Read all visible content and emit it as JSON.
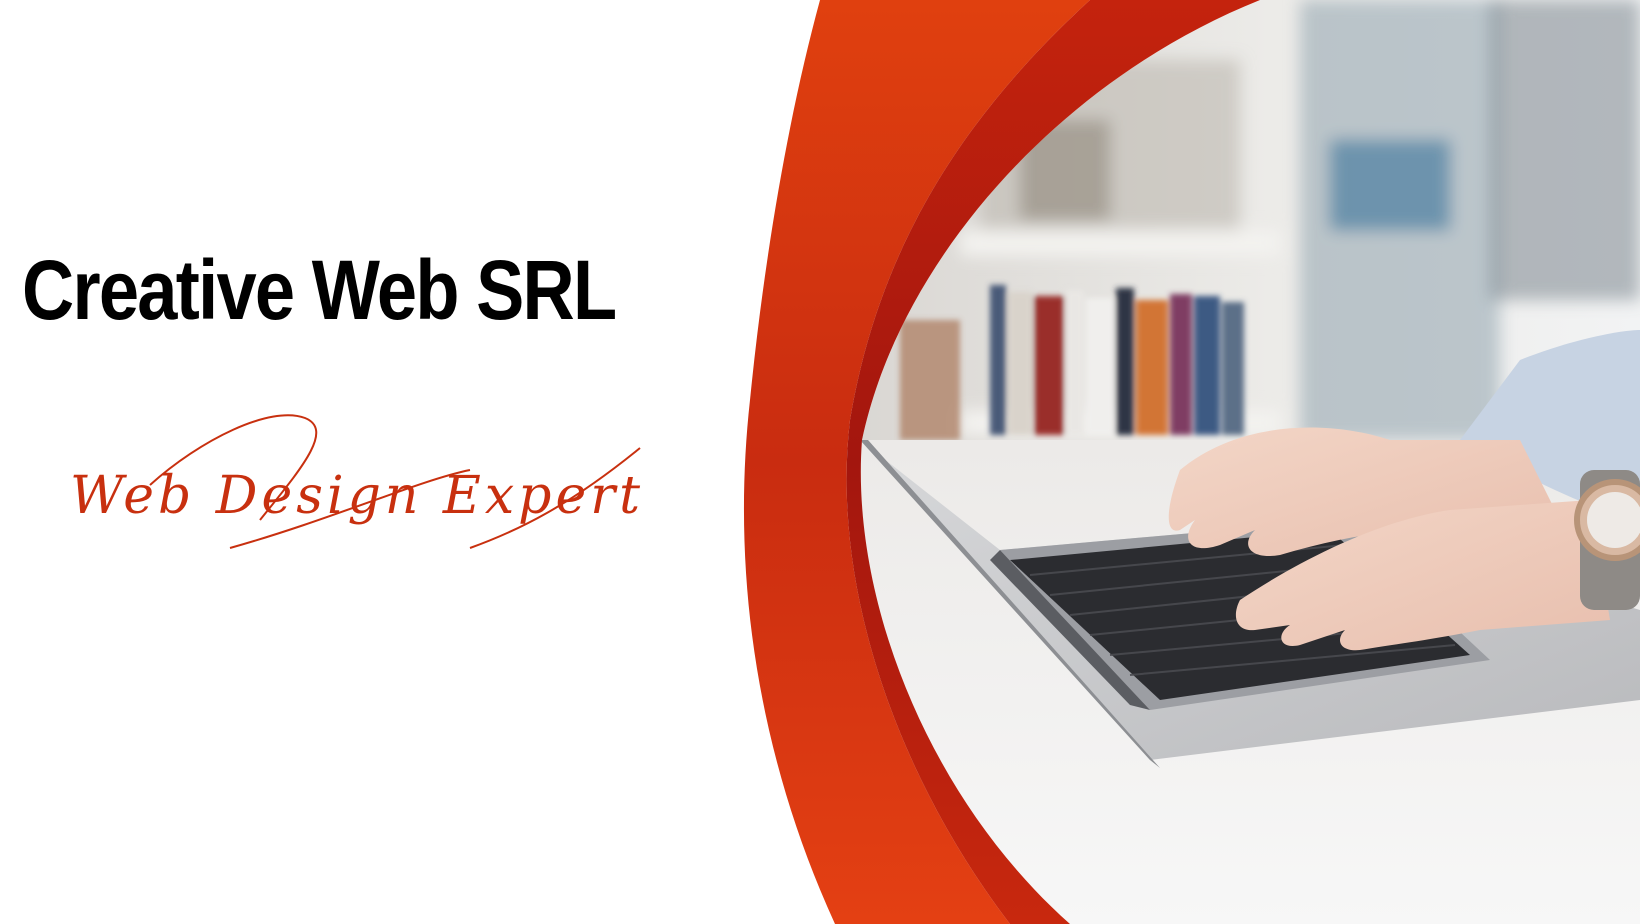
{
  "banner": {
    "title": "Creative Web SRL",
    "tagline": "Web Design Expert"
  },
  "colors": {
    "background": "#ffffff",
    "title": "#000000",
    "tagline": "#c8300f",
    "swoosh_dark": "#a3160e",
    "swoosh_bright": "#dd3a12"
  },
  "photo": {
    "subject": "hands typing on laptop keyboard",
    "icons": [
      "laptop-icon",
      "hands-icon",
      "wristwatch-icon",
      "bookshelf-icon"
    ]
  }
}
